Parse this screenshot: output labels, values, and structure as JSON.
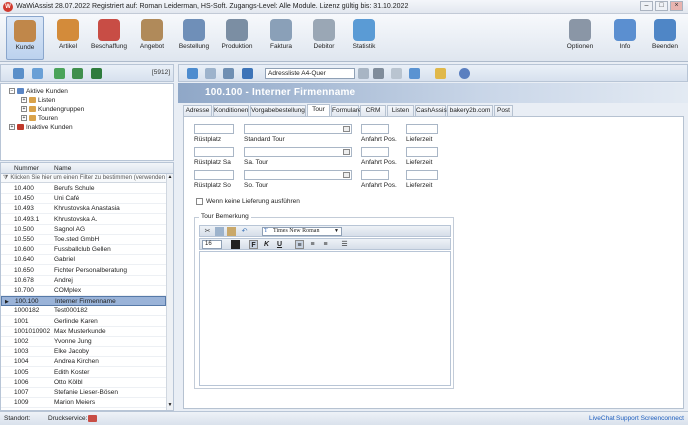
{
  "window": {
    "logo": "W",
    "title": "WaWiAssist 28.07.2022   Registriert auf: Roman Leiderman, HS-Soft.   Zugangs-Level: Alle Module.   Lizenz gültig bis: 31.10.2022"
  },
  "ribbon": {
    "left": [
      {
        "label": "Kunde",
        "icon": "customer-icon",
        "color": "#c0874a"
      },
      {
        "label": "Artikel",
        "icon": "article-icon",
        "color": "#d38b3a"
      },
      {
        "label": "Beschaffung",
        "icon": "procurement-icon",
        "color": "#c84d45"
      },
      {
        "label": "Angebot",
        "icon": "offer-icon",
        "color": "#b08a5a"
      },
      {
        "label": "Bestellung",
        "icon": "order-icon",
        "color": "#6f8fb8"
      },
      {
        "label": "Produktion",
        "icon": "production-icon",
        "color": "#7b8ea3"
      },
      {
        "label": "Faktura",
        "icon": "invoice-icon",
        "color": "#8aa0b8"
      },
      {
        "label": "Debitor",
        "icon": "debtor-icon",
        "color": "#9aa7b5"
      },
      {
        "label": "Statistik",
        "icon": "statistics-icon",
        "color": "#5a9bd5"
      }
    ],
    "right": [
      {
        "label": "Optionen",
        "icon": "options-icon",
        "color": "#8a96a6"
      },
      {
        "label": "Info",
        "icon": "info-icon",
        "color": "#5b8fd0"
      },
      {
        "label": "Beenden",
        "icon": "exit-icon",
        "color": "#4f86c6"
      }
    ]
  },
  "left_panel": {
    "count": "[5912]",
    "tree": [
      {
        "label": "Aktive Kunden",
        "level": 0,
        "expander": "−"
      },
      {
        "label": "Listen",
        "level": 1,
        "expander": "+"
      },
      {
        "label": "Kundengruppen",
        "level": 1,
        "expander": "+"
      },
      {
        "label": "Touren",
        "level": 1,
        "expander": "+"
      },
      {
        "label": "Inaktive Kunden",
        "level": 0,
        "expander": "+"
      }
    ],
    "grid": {
      "headers": {
        "nummer": "Nummer",
        "name": "Name"
      },
      "filter_placeholder": "Klicken Sie hier um einen Filter zu bestimmen (verwenden",
      "rows": [
        {
          "nummer": "10.400",
          "name": "Berufs Schule"
        },
        {
          "nummer": "10.450",
          "name": "Uni Café"
        },
        {
          "nummer": "10.493",
          "name": "Khrustovska Anastasia"
        },
        {
          "nummer": "10.493.1",
          "name": "Khrustovska A."
        },
        {
          "nummer": "10.500",
          "name": "Sagnol AG"
        },
        {
          "nummer": "10.550",
          "name": "Toe.sted GmbH"
        },
        {
          "nummer": "10.600",
          "name": "Fussballclub Gellen"
        },
        {
          "nummer": "10.640",
          "name": "Gabriel"
        },
        {
          "nummer": "10.650",
          "name": "Fichter Personalberatung"
        },
        {
          "nummer": "10.678",
          "name": "Andrej"
        },
        {
          "nummer": "10.700",
          "name": "COMplex"
        },
        {
          "nummer": "100.100",
          "name": "Interner Firmenname",
          "selected": true
        },
        {
          "nummer": "1000182",
          "name": "Test000182"
        },
        {
          "nummer": "1001",
          "name": "Gerlinde Karen"
        },
        {
          "nummer": "1001010902",
          "name": "Max Musterkunde"
        },
        {
          "nummer": "1002",
          "name": "Yvonne Jung"
        },
        {
          "nummer": "1003",
          "name": "Elke Jacoby"
        },
        {
          "nummer": "1004",
          "name": "Andrea Kirchen"
        },
        {
          "nummer": "1005",
          "name": "Edith Koster"
        },
        {
          "nummer": "1006",
          "name": "Otto Kölbl"
        },
        {
          "nummer": "1007",
          "name": "Stefanie Lieser-Bösen"
        },
        {
          "nummer": "1009",
          "name": "Marion Meiers"
        }
      ]
    }
  },
  "main": {
    "report": "Adressliste A4-Quer",
    "header_title": "100.100 - Interner Firmenname",
    "tabs": [
      "Adresse",
      "Konditionen",
      "Vorgabebestellung",
      "Tour",
      "Formulare",
      "CRM",
      "Listen",
      "CashAssist",
      "bakery2b.com",
      "Post"
    ],
    "active_tab": "Tour",
    "tour": {
      "rows": [
        {
          "platz": "Rüstplatz",
          "tour": "Standard Tour",
          "pos": "Anfahrt Pos.",
          "zeit": "Lieferzeit"
        },
        {
          "platz": "Rüstplatz Sa",
          "tour": "Sa. Tour",
          "pos": "Anfahrt Pos.",
          "zeit": "Lieferzeit"
        },
        {
          "platz": "Rüstplatz So",
          "tour": "So. Tour",
          "pos": "Anfahrt Pos.",
          "zeit": "Lieferzeit"
        }
      ],
      "no_delivery_label": "Wenn keine Lieferung ausführen",
      "remark_legend": "Tour Bemerkung",
      "editor": {
        "font": "Times New Roman",
        "size": "16",
        "bold": "F",
        "italic": "K",
        "underline": "U"
      }
    }
  },
  "status": {
    "standort_label": "Standort:",
    "druckservice_label": "Druckservice:",
    "livechat": "LiveChat",
    "support": "Support Screenconnect",
    "link_color": "#1f5fbf"
  }
}
